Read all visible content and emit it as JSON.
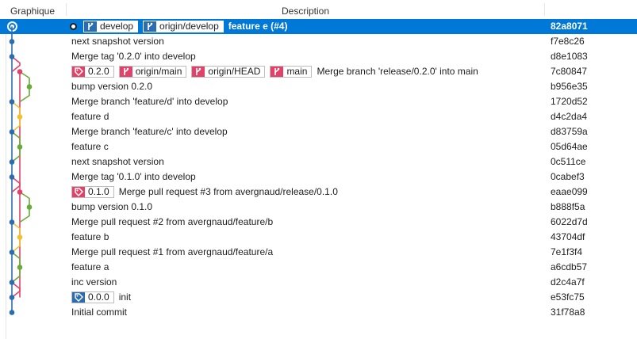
{
  "header": {
    "graph": "Graphique",
    "description": "Description"
  },
  "colors": {
    "blue": "#2c6db0",
    "pink": "#e0426a",
    "green": "#6aaa3a",
    "yellow": "#f0c030",
    "selected": "#0078d7"
  },
  "commits": [
    {
      "hash": "82a8071",
      "message": "feature e (#4)",
      "selected": true,
      "head": true,
      "refs": [
        {
          "label": "develop",
          "type": "branch",
          "color": "blue"
        },
        {
          "label": "origin/develop",
          "type": "branch",
          "color": "blue"
        }
      ]
    },
    {
      "hash": "f7e8c26",
      "message": "next snapshot version",
      "refs": []
    },
    {
      "hash": "d8e1083",
      "message": "Merge tag '0.2.0' into develop",
      "refs": []
    },
    {
      "hash": "7c80847",
      "message": "Merge branch 'release/0.2.0' into main",
      "refs": [
        {
          "label": "0.2.0",
          "type": "tag",
          "color": "pink"
        },
        {
          "label": "origin/main",
          "type": "branch",
          "color": "pink"
        },
        {
          "label": "origin/HEAD",
          "type": "branch",
          "color": "pink"
        },
        {
          "label": "main",
          "type": "branch",
          "color": "pink"
        }
      ]
    },
    {
      "hash": "b956e35",
      "message": "bump version 0.2.0",
      "refs": []
    },
    {
      "hash": "1720d52",
      "message": "Merge branch 'feature/d' into develop",
      "refs": []
    },
    {
      "hash": "d4c2da4",
      "message": "feature d",
      "refs": []
    },
    {
      "hash": "d83759a",
      "message": "Merge branch 'feature/c' into develop",
      "refs": []
    },
    {
      "hash": "05d64ae",
      "message": "feature c",
      "refs": []
    },
    {
      "hash": "0c511ce",
      "message": "next snapshot version",
      "refs": []
    },
    {
      "hash": "0cabef3",
      "message": "Merge tag '0.1.0' into develop",
      "refs": []
    },
    {
      "hash": "eaae099",
      "message": "Merge pull request #3 from avergnaud/release/0.1.0",
      "refs": [
        {
          "label": "0.1.0",
          "type": "tag",
          "color": "pink"
        }
      ]
    },
    {
      "hash": "b888f5a",
      "message": "bump version 0.1.0",
      "refs": []
    },
    {
      "hash": "6022d7d",
      "message": "Merge pull request #2 from avergnaud/feature/b",
      "refs": []
    },
    {
      "hash": "43704df",
      "message": "feature b",
      "refs": []
    },
    {
      "hash": "7e1f3f4",
      "message": "Merge pull request #1 from avergnaud/feature/a",
      "refs": []
    },
    {
      "hash": "a6cdb57",
      "message": "feature a",
      "refs": []
    },
    {
      "hash": "d2c4a7f",
      "message": "inc version",
      "refs": []
    },
    {
      "hash": "e53fc75",
      "message": "init",
      "refs": [
        {
          "label": "0.0.0",
          "type": "tag",
          "color": "blue"
        }
      ]
    },
    {
      "hash": "31f78a8",
      "message": "Initial commit",
      "refs": []
    }
  ]
}
